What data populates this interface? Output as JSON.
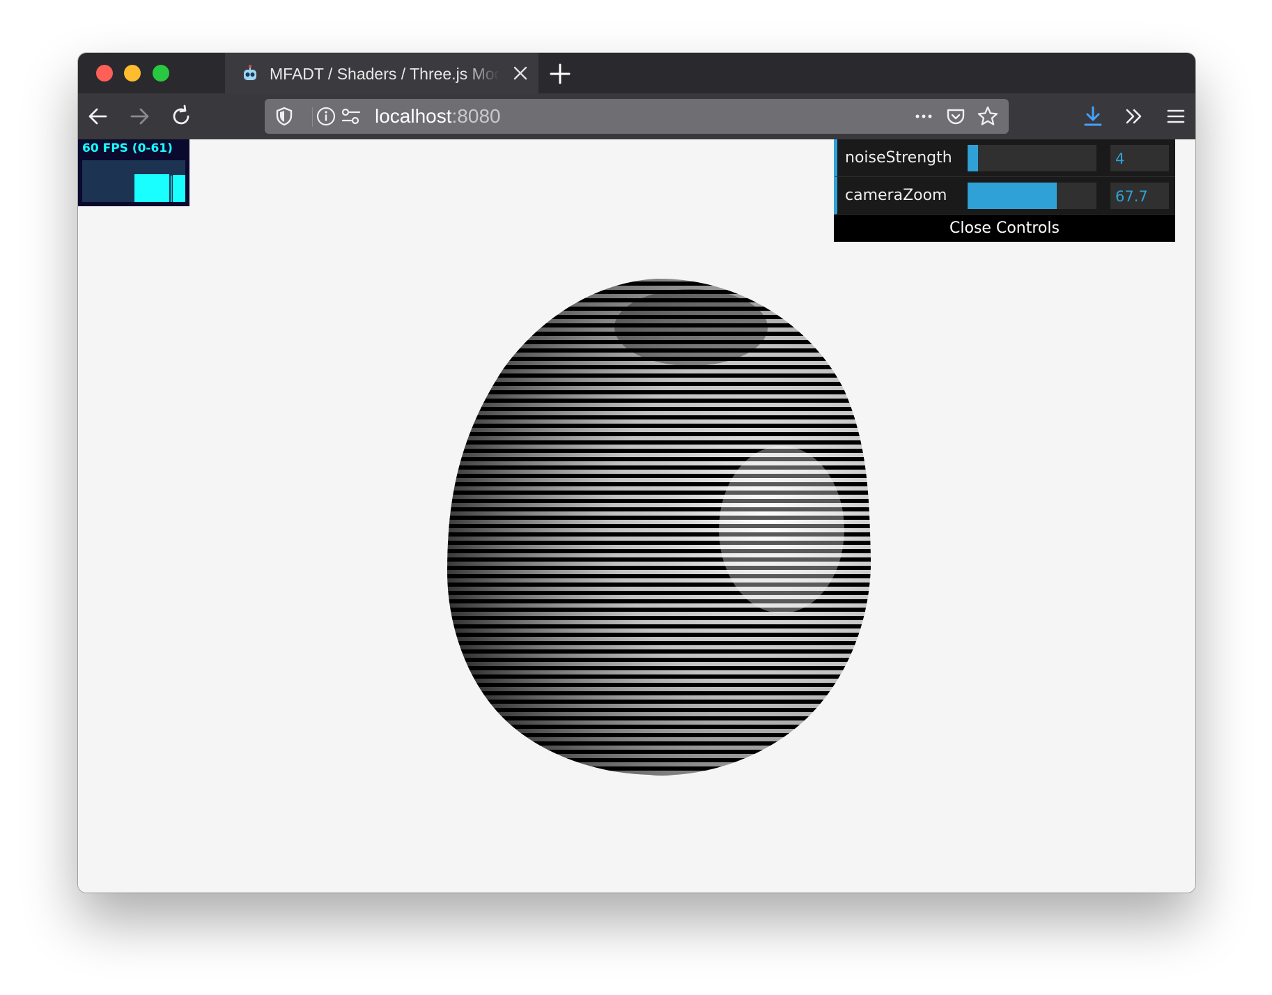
{
  "browser": {
    "tab_title": "MFADT / Shaders / Three.js Module",
    "url_host": "localhost",
    "url_port": ":8080"
  },
  "stats": {
    "fps_label": "60 FPS (0-61)",
    "fps": 60,
    "fps_min": 0,
    "fps_max": 61
  },
  "controls": {
    "items": [
      {
        "label": "noiseStrength",
        "value": "4",
        "fill": 0.08
      },
      {
        "label": "cameraZoom",
        "value": "67.7",
        "fill": 0.69
      }
    ],
    "close_label": "Close Controls"
  },
  "colors": {
    "accent": "#2fa1d6",
    "stats_text": "#19ffff",
    "tab_bar": "#2a2a2e",
    "nav_bar": "#38383d",
    "download": "#45a1ff"
  },
  "icons": {
    "back": "arrow-left-icon",
    "forward": "arrow-right-icon",
    "reload": "reload-icon",
    "shield": "shield-icon",
    "info": "info-icon",
    "permissions": "permissions-icon",
    "more": "more-dots-icon",
    "pocket": "pocket-icon",
    "bookmark": "star-icon",
    "downloads": "download-icon",
    "overflow": "chevron-double-right-icon",
    "menu": "hamburger-menu-icon"
  }
}
